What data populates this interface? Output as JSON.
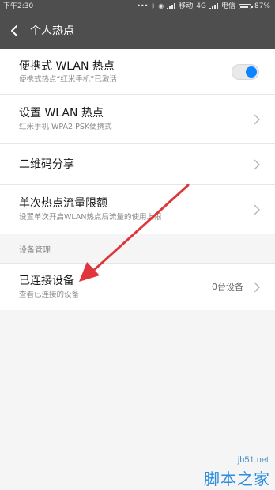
{
  "status_bar": {
    "time": "下午2:30",
    "network_type": "4G",
    "carrier_1": "移动",
    "carrier_2": "电信",
    "battery_percent": "87%",
    "battery_level": 0.87
  },
  "header": {
    "title": "个人热点"
  },
  "settings": {
    "portable_hotspot": {
      "title": "便携式 WLAN 热点",
      "subtitle": "便携式热点“红米手机”已激活",
      "enabled": true
    },
    "configure_hotspot": {
      "title": "设置 WLAN 热点",
      "subtitle": "红米手机 WPA2 PSK便携式"
    },
    "qr_share": {
      "title": "二维码分享"
    },
    "data_limit": {
      "title": "单次热点流量限额",
      "subtitle": "设置单次开启WLAN热点后流量的使用上限"
    }
  },
  "device_management": {
    "section_label": "设备管理",
    "connected_devices": {
      "title": "已连接设备",
      "subtitle": "查看已连接的设备",
      "count": "0台设备"
    }
  },
  "colors": {
    "header_bg": "#4e4e4e",
    "toggle_on": "#0d84ff",
    "annotation_arrow": "#e0353a"
  },
  "watermark": {
    "domain": "jb51.net",
    "name": "脚本之家"
  }
}
